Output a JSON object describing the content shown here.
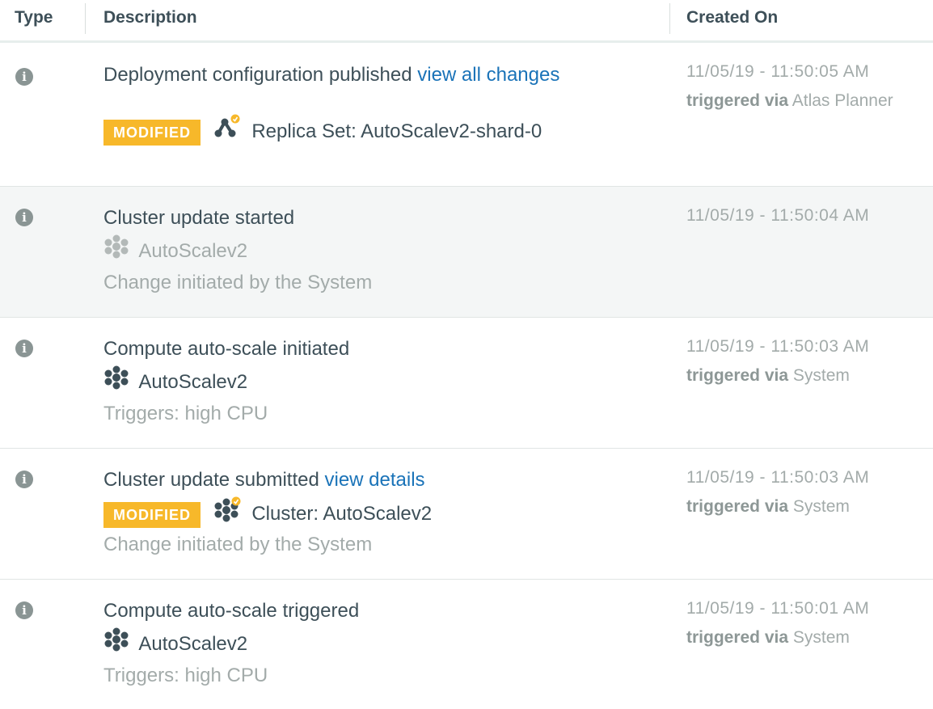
{
  "header": {
    "type_label": "Type",
    "description_label": "Description",
    "created_label": "Created On"
  },
  "triggered_label": "triggered via",
  "rows": [
    {
      "title": "Deployment configuration published",
      "link": "view all changes",
      "badge": "MODIFIED",
      "item_icon": "replica-set-icon",
      "item_label": "Replica Set: AutoScalev2-shard-0",
      "date": "11/05/19 - 11:50:05 AM",
      "triggered_by": "Atlas Planner"
    },
    {
      "title": "Cluster update started",
      "item_icon": "cluster-icon",
      "item_label": "AutoScalev2",
      "note": "Change initiated by the System",
      "date": "11/05/19 - 11:50:04 AM"
    },
    {
      "title": "Compute auto-scale initiated",
      "item_icon": "cluster-icon",
      "item_label": "AutoScalev2",
      "note": "Triggers: high CPU",
      "date": "11/05/19 - 11:50:03 AM",
      "triggered_by": "System"
    },
    {
      "title": "Cluster update submitted",
      "link": "view details",
      "badge": "MODIFIED",
      "item_icon": "cluster-icon",
      "item_label": "Cluster: AutoScalev2",
      "note": "Change initiated by the System",
      "date": "11/05/19 - 11:50:03 AM",
      "triggered_by": "System"
    },
    {
      "title": "Compute auto-scale triggered",
      "item_icon": "cluster-icon",
      "item_label": "AutoScalev2",
      "note": "Triggers: high CPU",
      "date": "11/05/19 - 11:50:01 AM",
      "triggered_by": "System"
    }
  ],
  "colors": {
    "accent_link": "#1a73b8",
    "badge_bg": "#f7b82a",
    "highlight_row": "#f4f6f6"
  }
}
